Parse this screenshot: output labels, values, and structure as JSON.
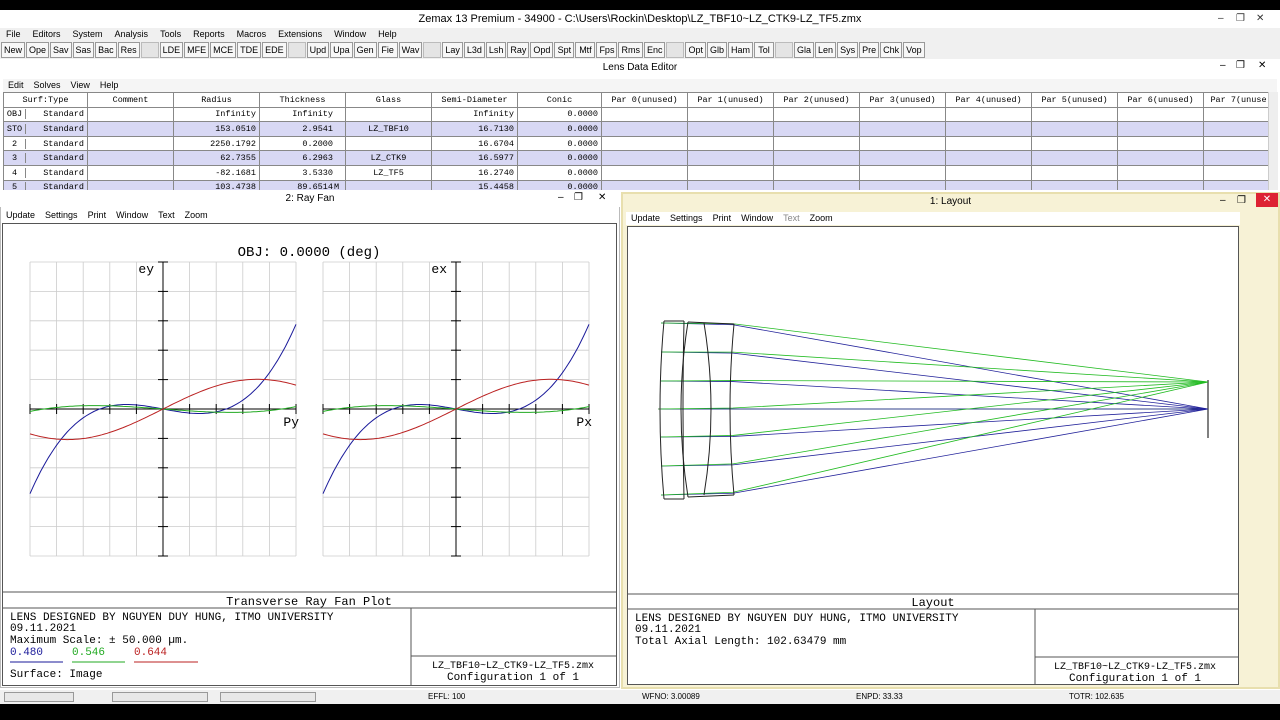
{
  "app": {
    "title": "Zemax 13 Premium - 34900 - C:\\Users\\Rockin\\Desktop\\LZ_TBF10~LZ_CTK9-LZ_TF5.zmx",
    "menu": [
      "File",
      "Editors",
      "System",
      "Analysis",
      "Tools",
      "Reports",
      "Macros",
      "Extensions",
      "Window",
      "Help"
    ],
    "toolbar_group1": [
      "New",
      "Ope",
      "Sav",
      "Sas",
      "Bac",
      "Res"
    ],
    "toolbar_group2": [
      "LDE",
      "MFE",
      "MCE",
      "TDE",
      "EDE"
    ],
    "toolbar_group3": [
      "Upd",
      "Upa",
      "Gen",
      "Fie",
      "Wav"
    ],
    "toolbar_group4": [
      "Lay",
      "L3d",
      "Lsh",
      "Ray",
      "Opd",
      "Spt",
      "Mtf",
      "Fps",
      "Rms",
      "Enc"
    ],
    "toolbar_group5": [
      "Opt",
      "Glb",
      "Ham",
      "Tol"
    ],
    "toolbar_group6": [
      "Gla",
      "Len",
      "Sys",
      "Pre",
      "Chk",
      "Vop"
    ]
  },
  "lde": {
    "title": "Lens Data Editor",
    "menu": [
      "Edit",
      "Solves",
      "View",
      "Help"
    ],
    "headers": [
      "Surf:Type",
      "Comment",
      "Radius",
      "Thickness",
      "Glass",
      "Semi-Diameter",
      "Conic",
      "Par 0(unused)",
      "Par 1(unused)",
      "Par 2(unused)",
      "Par 3(unused)",
      "Par 4(unused)",
      "Par 5(unused)",
      "Par 6(unused)",
      "Par 7(unuse"
    ],
    "rows": [
      {
        "surf": "OBJ",
        "type": "Standard",
        "comment": "",
        "radius": "Infinity",
        "thickness": "Infinity",
        "glass": "",
        "semi": "Infinity",
        "conic": "0.0000",
        "m": ""
      },
      {
        "surf": "STO",
        "type": "Standard",
        "comment": "",
        "radius": "153.0510",
        "thickness": "2.9541",
        "glass": "LZ_TBF10",
        "semi": "16.7130",
        "conic": "0.0000",
        "m": ""
      },
      {
        "surf": "2",
        "type": "Standard",
        "comment": "",
        "radius": "2250.1792",
        "thickness": "0.2000",
        "glass": "",
        "semi": "16.6704",
        "conic": "0.0000",
        "m": ""
      },
      {
        "surf": "3",
        "type": "Standard",
        "comment": "",
        "radius": "62.7355",
        "thickness": "6.2963",
        "glass": "LZ_CTK9",
        "semi": "16.5977",
        "conic": "0.0000",
        "m": ""
      },
      {
        "surf": "4",
        "type": "Standard",
        "comment": "",
        "radius": "-82.1681",
        "thickness": "3.5330",
        "glass": "LZ_TF5",
        "semi": "16.2740",
        "conic": "0.0000",
        "m": ""
      },
      {
        "surf": "5",
        "type": "Standard",
        "comment": "",
        "radius": "103.4738",
        "thickness": "89.6514",
        "glass": "",
        "semi": "15.4458",
        "conic": "0.0000",
        "m": "M"
      }
    ]
  },
  "rayfan": {
    "title": "2: Ray Fan",
    "menu": [
      "Update",
      "Settings",
      "Print",
      "Window",
      "Text",
      "Zoom"
    ],
    "heading": "OBJ: 0.0000 (deg)",
    "left_axis": "ey",
    "left_xlabel": "Py",
    "right_axis": "ex",
    "right_xlabel": "Px",
    "plot_title": "Transverse Ray Fan Plot",
    "info_line1": "LENS DESIGNED BY NGUYEN DUY HUNG, ITMO UNIVERSITY",
    "info_line2": "09.11.2021",
    "info_line3": "Maximum Scale: ± 50.000 µm.",
    "wave1": "0.480",
    "wave2": "0.546",
    "wave3": "0.644",
    "info_line5": "Surface: Image",
    "file": "LZ_TBF10~LZ_CTK9-LZ_TF5.zmx",
    "config": "Configuration 1 of 1",
    "colors": {
      "blue": "#1a1a9a",
      "green": "#22aa22",
      "red": "#bb2222"
    }
  },
  "layout": {
    "title": "1: Layout",
    "menu": [
      "Update",
      "Settings",
      "Print",
      "Window",
      "Text",
      "Zoom"
    ],
    "plot_title": "Layout",
    "info_line1": "LENS DESIGNED BY NGUYEN DUY HUNG, ITMO UNIVERSITY",
    "info_line2": "09.11.2021",
    "info_line3": "Total Axial Length:  102.63479 mm",
    "file": "LZ_TBF10~LZ_CTK9-LZ_TF5.zmx",
    "config": "Configuration 1 of 1"
  },
  "status": {
    "effl": "EFFL: 100",
    "wfno": "WFNO: 3.00089",
    "enpd": "ENPD: 33.33",
    "totr": "TOTR: 102.635"
  }
}
